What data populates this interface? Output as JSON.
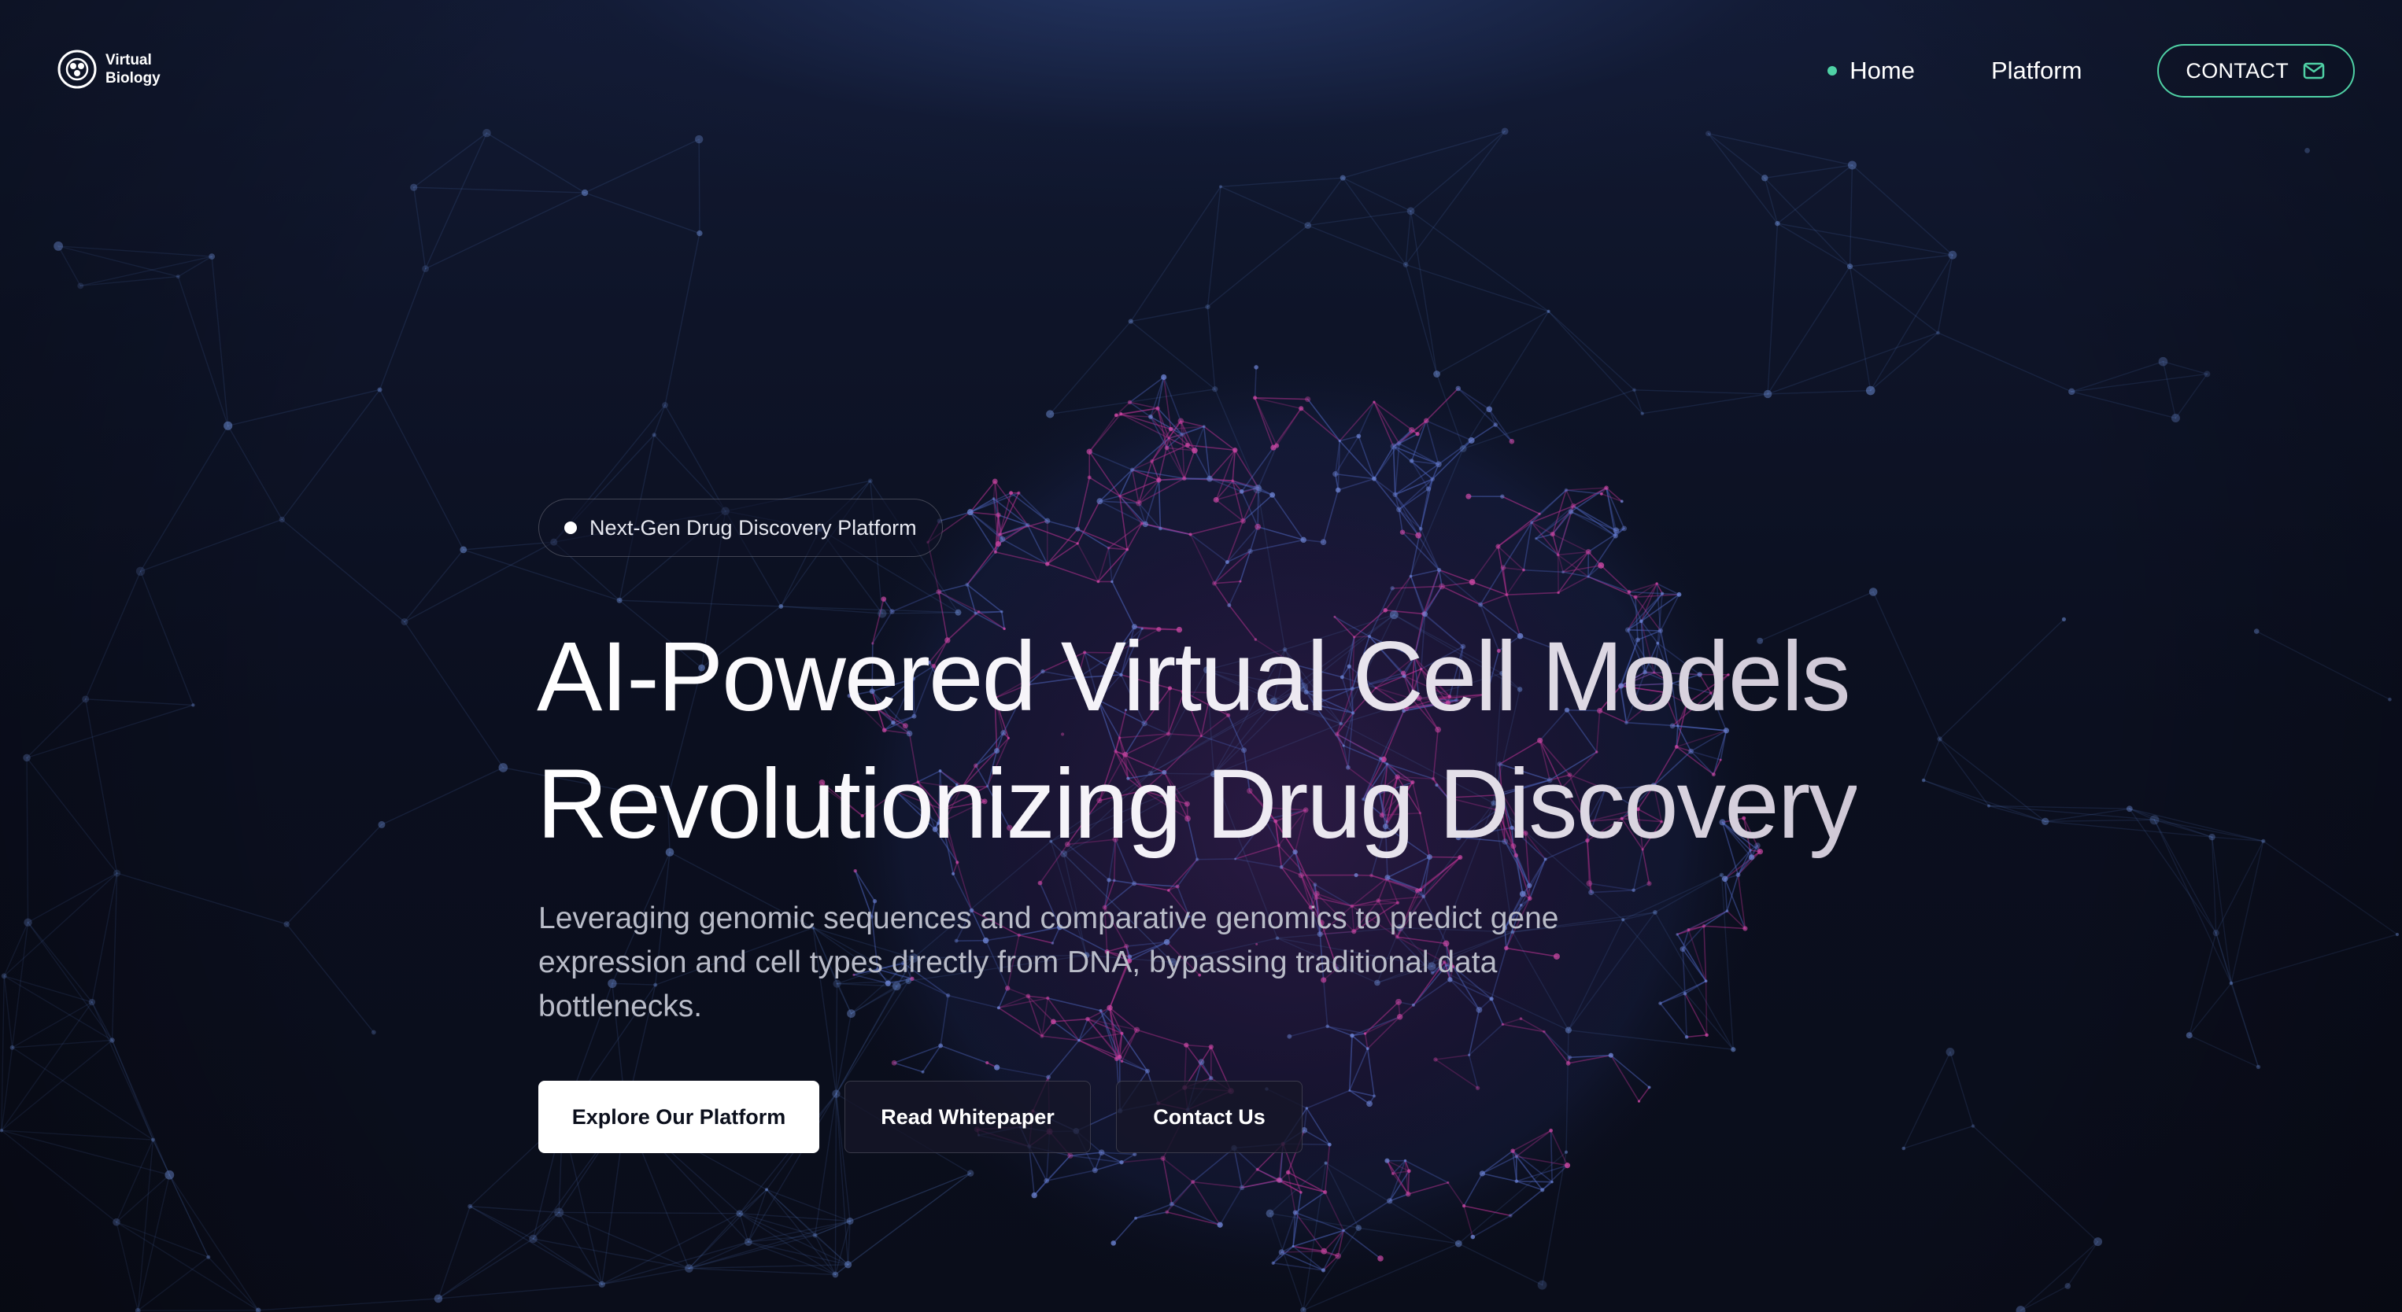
{
  "brand": {
    "name_line1": "Virtual",
    "name_line2": "Biology",
    "logo_icon": "cell-logo-icon"
  },
  "nav": {
    "items": [
      {
        "label": "Home",
        "active": true
      },
      {
        "label": "Platform",
        "active": false
      }
    ],
    "contact_label": "CONTACT",
    "contact_icon": "mail-icon"
  },
  "hero": {
    "badge": "Next-Gen Drug Discovery Platform",
    "title_line1": "AI-Powered Virtual Cell Models",
    "title_line2": "Revolutionizing Drug Discovery",
    "subtitle": "Leveraging genomic sequences and comparative genomics to predict gene expression and cell types directly from DNA, bypassing traditional data bottlenecks.",
    "buttons": {
      "primary": "Explore Our Platform",
      "whitepaper": "Read Whitepaper",
      "contact": "Contact Us"
    }
  },
  "colors": {
    "accent": "#4fd1a5",
    "background": "#0b0f1c",
    "sphere_magenta": "#b02a8a",
    "sphere_blue": "#4a5fb0"
  }
}
